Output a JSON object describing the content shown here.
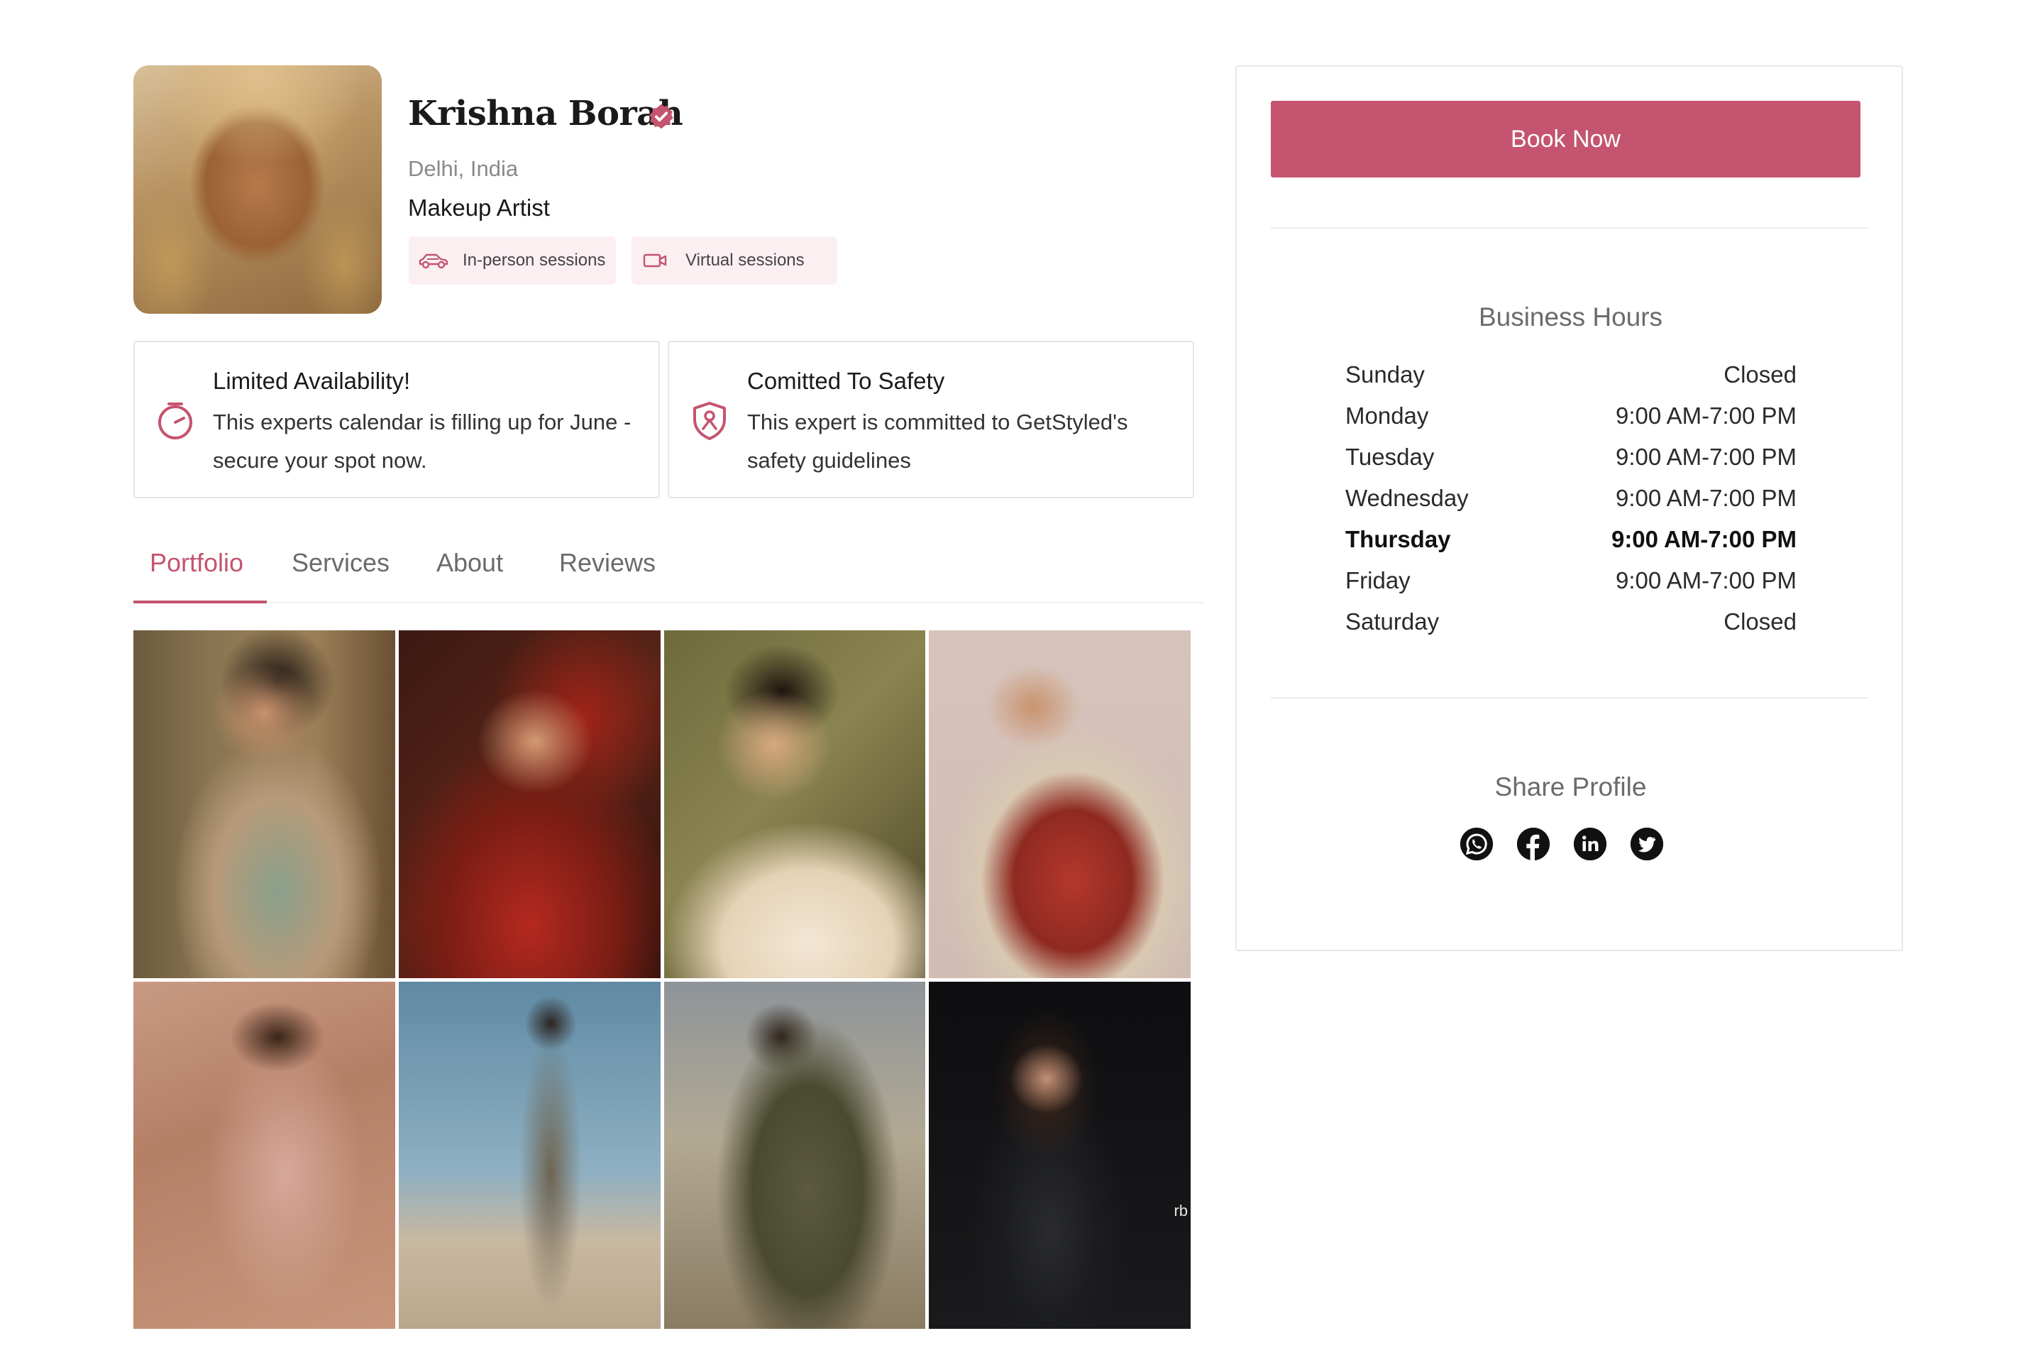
{
  "profile": {
    "name": "Krishna Borah",
    "location": "Delhi, India",
    "role": "Makeup Artist",
    "session_types": [
      "In-person sessions",
      "Virtual sessions"
    ]
  },
  "cards": {
    "availability": {
      "title": "Limited Availability!",
      "text": "This experts calendar is filling up for June - secure your spot now."
    },
    "safety": {
      "title": "Comitted To Safety",
      "text": "This expert is committed to GetStyled's safety guidelines"
    }
  },
  "tabs": [
    "Portfolio",
    "Services",
    "About",
    "Reviews"
  ],
  "active_tab": "Portfolio",
  "gallery": {
    "photo_count": 8,
    "watermark": "rb"
  },
  "panel": {
    "book_label": "Book Now",
    "hours_title": "Business Hours",
    "hours": [
      {
        "day": "Sunday",
        "time": "Closed"
      },
      {
        "day": "Monday",
        "time": "9:00 AM-7:00 PM"
      },
      {
        "day": "Tuesday",
        "time": "9:00 AM-7:00 PM"
      },
      {
        "day": "Wednesday",
        "time": "9:00 AM-7:00 PM"
      },
      {
        "day": "Thursday",
        "time": "9:00 AM-7:00 PM",
        "today": true
      },
      {
        "day": "Friday",
        "time": "9:00 AM-7:00 PM"
      },
      {
        "day": "Saturday",
        "time": "Closed"
      }
    ],
    "share_title": "Share Profile",
    "share_icons": [
      "whatsapp-icon",
      "facebook-icon",
      "linkedin-icon",
      "twitter-icon"
    ]
  },
  "colors": {
    "accent": "#c4546f",
    "chip_bg": "#fbeff2",
    "border": "#e6e6e6"
  }
}
